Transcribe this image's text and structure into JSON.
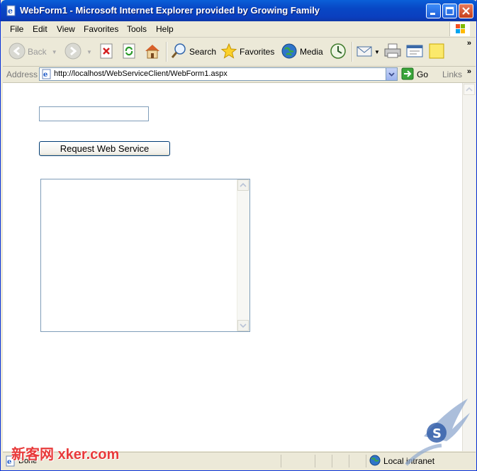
{
  "window": {
    "title": "WebForm1 - Microsoft Internet Explorer provided by Growing Family"
  },
  "menu": {
    "items": [
      "File",
      "Edit",
      "View",
      "Favorites",
      "Tools",
      "Help"
    ]
  },
  "toolbar": {
    "back_label": "Back",
    "search_label": "Search",
    "favorites_label": "Favorites",
    "media_label": "Media"
  },
  "address": {
    "label": "Address",
    "url": "http://localhost/WebServiceClient/WebForm1.aspx",
    "go_label": "Go",
    "links_label": "Links"
  },
  "page": {
    "text_input_value": "",
    "request_button_label": "Request Web Service",
    "textarea_value": ""
  },
  "status": {
    "text": "Done",
    "zone": "Local intranet"
  },
  "watermark": {
    "left_text": "新客网 xker.com"
  },
  "colors": {
    "titlebar": "#0a4fd0",
    "chrome": "#ece9d8",
    "input_border": "#7f9db9"
  }
}
